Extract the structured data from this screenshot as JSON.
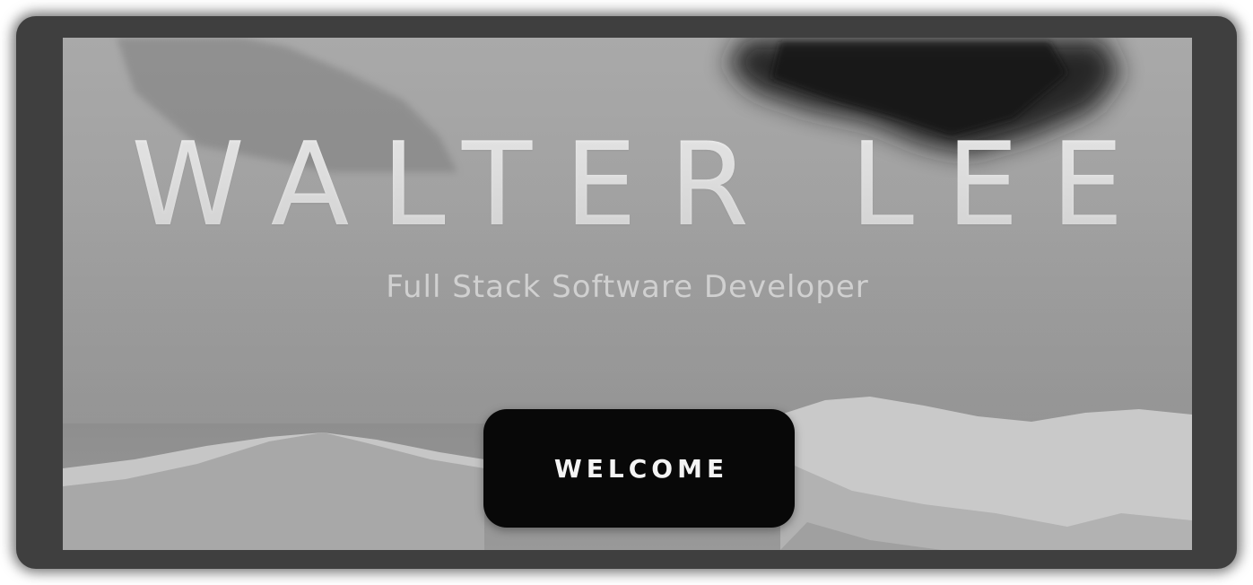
{
  "hero": {
    "title": "WALTER LEE",
    "subtitle": "Full Stack Software Developer",
    "cta_label": "WELCOME"
  },
  "colors": {
    "frame": "#3f3f3f",
    "button_bg": "#080808",
    "button_text": "#f4f4f4",
    "title_text": "#e4e4e4",
    "subtitle_text": "#d0d0d0"
  }
}
